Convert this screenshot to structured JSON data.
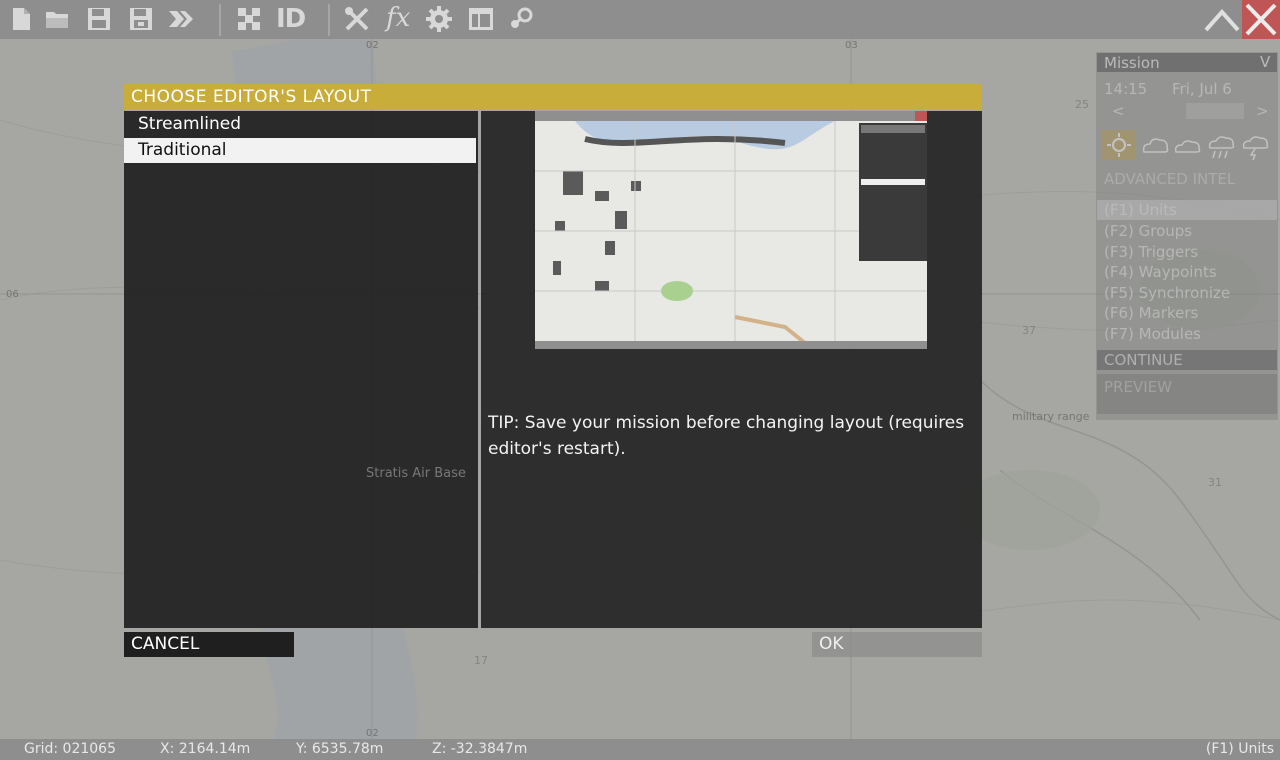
{
  "toolbar": {
    "icons": [
      "new-file-icon",
      "open-folder-icon",
      "save-icon",
      "save-as-icon",
      "export-icon",
      "grid-icon",
      "id-icon",
      "tools-icon",
      "functions-icon",
      "settings-icon",
      "layout-icon",
      "steam-icon"
    ],
    "id_label": "ID",
    "fx_label": "fx"
  },
  "map_labels": {
    "grid_02_top": "02",
    "grid_03_top": "03",
    "grid_02_bottom": "02",
    "grid_06": "06",
    "grid_25": "25",
    "grid_37": "37",
    "grid_31": "31",
    "grid_17": "17",
    "military_range": "military range",
    "stratis_air_base": "Stratis Air Base"
  },
  "side_panel": {
    "header": "Mission",
    "time": "14:15",
    "date": "Fri, Jul 6",
    "prev": "<",
    "next": ">",
    "weather": [
      "sunny-icon",
      "partly-cloudy-icon",
      "cloudy-icon",
      "rain-icon",
      "storm-icon"
    ],
    "advanced_intel": "ADVANCED INTEL",
    "items": [
      "(F1) Units",
      "(F2) Groups",
      "(F3) Triggers",
      "(F4) Waypoints",
      "(F5) Synchronize",
      "(F6) Markers",
      "(F7) Modules"
    ],
    "continue": "CONTINUE",
    "preview": "PREVIEW"
  },
  "dialog": {
    "title": "CHOOSE EDITOR'S LAYOUT",
    "options": [
      "Streamlined",
      "Traditional"
    ],
    "selected_index": 1,
    "tip": "TIP: Save your mission before changing layout (requires editor's restart).",
    "cancel": "CANCEL",
    "ok": "OK"
  },
  "status": {
    "grid": "Grid: 021065",
    "x": "X: 2164.14m",
    "y": "Y: 6535.78m",
    "z": "Z: -32.3847m",
    "mode": "(F1) Units"
  }
}
